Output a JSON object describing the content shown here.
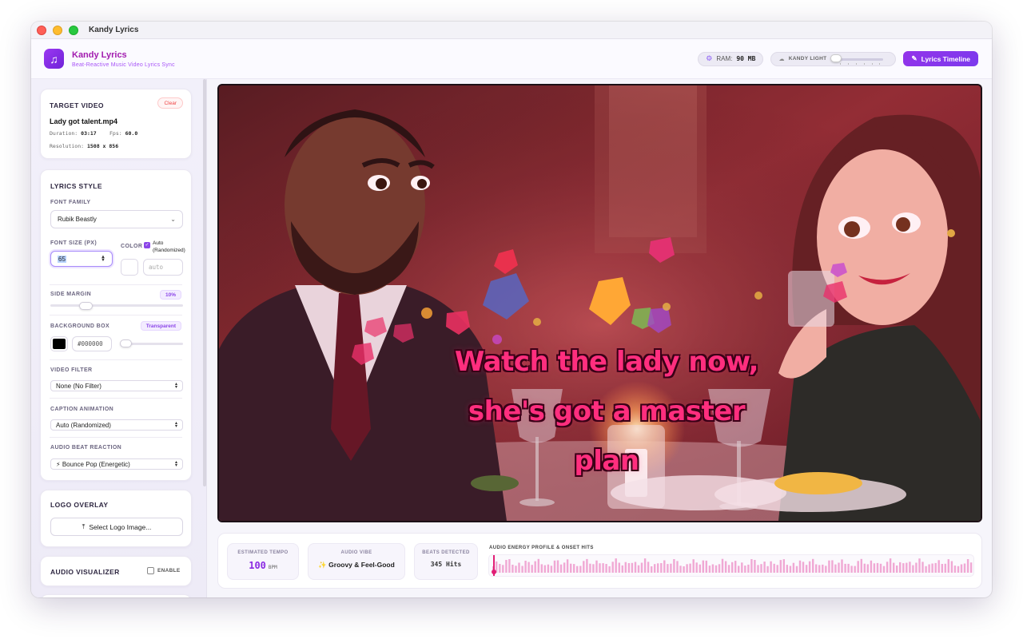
{
  "window": {
    "title": "Kandy Lyrics"
  },
  "header": {
    "app_name": "Kandy Lyrics",
    "app_subtitle": "Beat-Reactive Music Video Lyrics Sync",
    "ram_label": "RAM:",
    "ram_value": "90 MB",
    "theme_label": "KANDY LIGHT",
    "timeline_button": "Lyrics Timeline",
    "brand_color": "#9333ea"
  },
  "target_video": {
    "title": "TARGET VIDEO",
    "clear_label": "Clear",
    "filename": "Lady got talent.mp4",
    "duration_label": "Duration:",
    "duration": "03:17",
    "fps_label": "Fps:",
    "fps": "60.0",
    "resolution_label": "Resolution:",
    "resolution": "1508 x 856"
  },
  "lyrics_style": {
    "title": "LYRICS STYLE",
    "font_family_label": "FONT FAMILY",
    "font_family_value": "Rubik Beastly",
    "font_size_label": "FONT SIZE (PX)",
    "font_size_value": "65",
    "color_label": "COLOR",
    "auto_color_label": "Auto (Randomized)",
    "auto_color_checked": true,
    "color_placeholder": "auto",
    "side_margin_label": "SIDE MARGIN",
    "side_margin_value": "10%",
    "background_box_label": "BACKGROUND BOX",
    "background_box_tag": "Transparent",
    "background_color": "#000000",
    "video_filter_label": "VIDEO FILTER",
    "video_filter_value": "None (No Filter)",
    "caption_animation_label": "CAPTION ANIMATION",
    "caption_animation_value": "Auto (Randomized)",
    "audio_beat_label": "AUDIO BEAT REACTION",
    "audio_beat_value": "⚡ Bounce Pop (Energetic)"
  },
  "logo_overlay": {
    "title": "LOGO OVERLAY",
    "button": "Select Logo Image..."
  },
  "audio_visualizer": {
    "title": "AUDIO VISUALIZER",
    "enable_label": "ENABLE",
    "enabled": false
  },
  "video": {
    "lyrics_lines": [
      "Watch the lady now,",
      "she's got a master",
      "plan"
    ],
    "lyrics_color": "#ff2e7e"
  },
  "stats": {
    "tempo_label": "ESTIMATED TEMPO",
    "tempo_value": "100",
    "tempo_unit": "BPM",
    "vibe_label": "AUDIO VIBE",
    "vibe_value": "✨ Groovy & Feel-Good",
    "beats_label": "BEATS DETECTED",
    "beats_value": "345 Hits",
    "energy_label": "AUDIO ENERGY PROFILE & ONSET HITS",
    "playhead_fraction": 0.005
  }
}
